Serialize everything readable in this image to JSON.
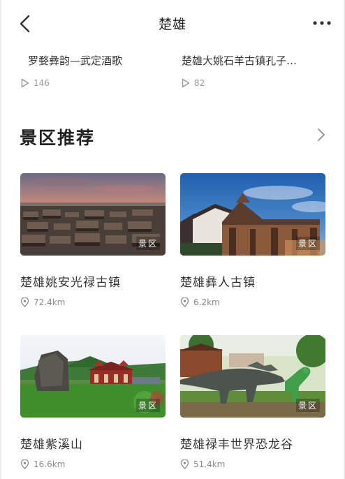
{
  "header": {
    "title": "楚雄"
  },
  "previous_row": [
    {
      "title": "罗婺彝韵—武定酒歌",
      "plays": "146"
    },
    {
      "title": "楚雄大姚石羊古镇孔子…",
      "plays": "82"
    }
  ],
  "section": {
    "title": "景区推荐"
  },
  "cards": [
    {
      "name": "楚雄姚安光禄古镇",
      "tag": "景区",
      "distance": "72.4km"
    },
    {
      "name": "楚雄彝人古镇",
      "tag": "景区",
      "distance": "6.2km"
    },
    {
      "name": "楚雄紫溪山",
      "tag": "景区",
      "distance": "16.6km"
    },
    {
      "name": "楚雄禄丰世界恐龙谷",
      "tag": "景区",
      "distance": "51.4km"
    }
  ]
}
